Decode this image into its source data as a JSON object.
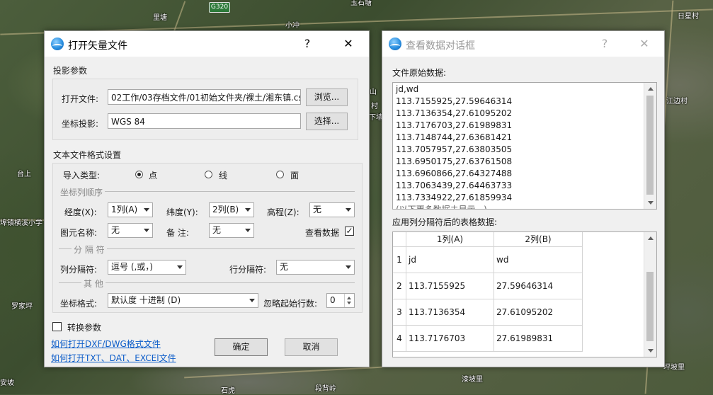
{
  "map": {
    "labels": [
      "里塘",
      "小冲",
      "玉石塘",
      "日星村",
      "江边村",
      "台上",
      "埠镇横溪小学",
      "罗家坪",
      "安坡",
      "石虎",
      "段背岭",
      "漆坡里",
      "坪坡里",
      "村",
      "下墙",
      "山"
    ],
    "road_shield": "G320"
  },
  "open_dialog": {
    "title": "打开矢量文件",
    "help": "?",
    "close": "✕",
    "projection_group": "投影参数",
    "open_file_label": "打开文件:",
    "open_file_value": "02工作/03存档文件/01初始文件夹/裸土/湘东镇.cs",
    "browse_button": "浏览...",
    "coord_proj_label": "坐标投影:",
    "coord_proj_value": "WGS 84",
    "select_button": "选择...",
    "format_group": "文本文件格式设置",
    "import_type_label": "导入类型:",
    "import_types": [
      "点",
      "线",
      "面"
    ],
    "import_type_selected": "点",
    "coord_order_sep": "坐标列顺序",
    "lon_label": "经度(X):",
    "lon_value": "1列(A)",
    "lat_label": "纬度(Y):",
    "lat_value": "2列(B)",
    "elev_label": "高程(Z):",
    "elev_value": "无",
    "feature_name_label": "图元名称:",
    "feature_name_value": "无",
    "remark_label": "备   注:",
    "remark_value": "无",
    "view_data_label": "查看数据",
    "view_data_checked": "✓",
    "delimiter_sep": "分 隔 符",
    "col_delim_label": "列分隔符:",
    "col_delim_value": "逗号 (,或，)",
    "row_delim_label": "行分隔符:",
    "row_delim_value": "无",
    "other_sep": "其 他",
    "coord_format_label": "坐标格式:",
    "coord_format_value": "默认度 十进制 (D)",
    "skip_rows_label": "忽略起始行数:",
    "skip_rows_value": "0",
    "convert_params_label": "转换参数",
    "link_dxf": "如何打开DXF/DWG格式文件",
    "link_txt": "如何打开TXT、DAT、EXCEl文件",
    "ok_button": "确定",
    "cancel_button": "取消"
  },
  "view_dialog": {
    "title": "查看数据对话框",
    "help": "?",
    "close": "✕",
    "raw_label": "文件原始数据:",
    "raw_lines": [
      "jd,wd",
      "113.7155925,27.59646314",
      "113.7136354,27.61095202",
      "113.7176703,27.61989831",
      "113.7148744,27.63681421",
      "113.7057957,27.63803505",
      "113.6950175,27.63761508",
      "113.6960866,27.64327488",
      "113.7063439,27.64463733",
      "113.7334922,27.61859934",
      "(以下更多数据未显示...)"
    ],
    "table_label": "应用列分隔符后的表格数据:",
    "columns": [
      "1列(A)",
      "2列(B)"
    ],
    "rows": [
      {
        "n": "1",
        "a": "jd",
        "b": "wd"
      },
      {
        "n": "2",
        "a": "113.7155925",
        "b": "27.59646314"
      },
      {
        "n": "3",
        "a": "113.7136354",
        "b": "27.61095202"
      },
      {
        "n": "4",
        "a": "113.7176703",
        "b": "27.61989831"
      }
    ]
  }
}
